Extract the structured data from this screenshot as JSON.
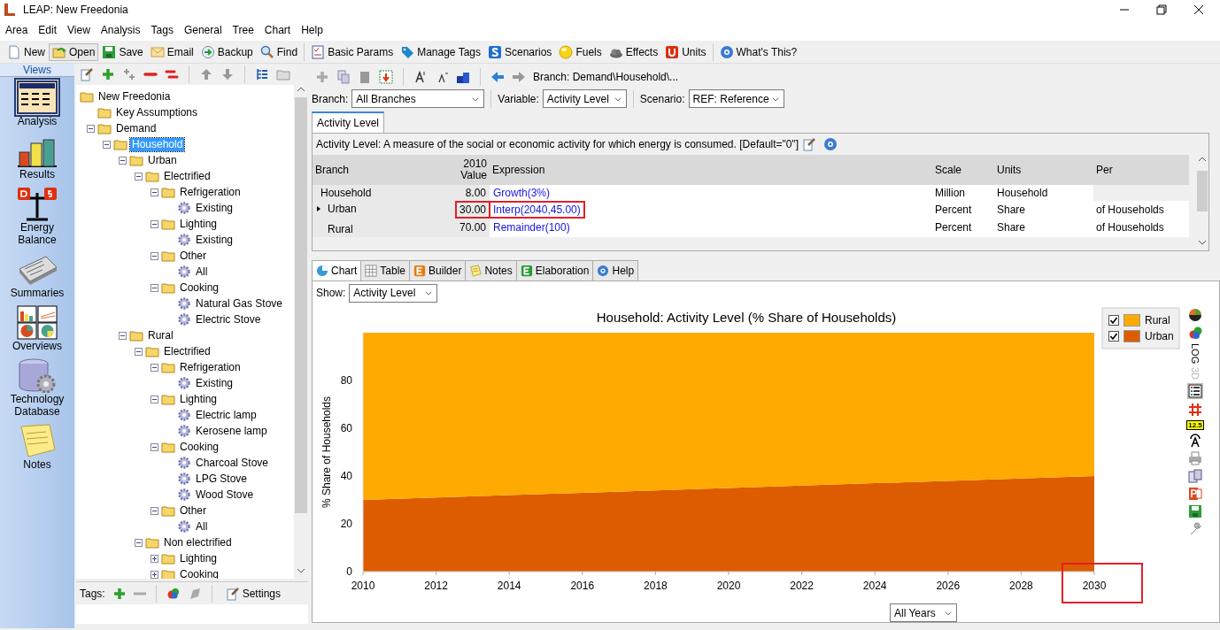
{
  "window": {
    "title": "LEAP: New Freedonia"
  },
  "menu": [
    "Area",
    "Edit",
    "View",
    "Analysis",
    "Tags",
    "General",
    "Tree",
    "Chart",
    "Help"
  ],
  "toolbar": [
    {
      "label": "New",
      "active": false
    },
    {
      "label": "Open",
      "active": true
    },
    {
      "label": "Save",
      "active": false
    },
    {
      "label": "Email",
      "active": false
    },
    {
      "label": "Backup",
      "active": false
    },
    {
      "label": "Find",
      "active": false
    },
    {
      "label": "Basic Params",
      "active": false
    },
    {
      "label": "Manage Tags",
      "active": false
    },
    {
      "label": "Scenarios",
      "active": false
    },
    {
      "label": "Fuels",
      "active": false
    },
    {
      "label": "Effects",
      "active": false
    },
    {
      "label": "Units",
      "active": false
    },
    {
      "label": "What's This?",
      "active": false
    }
  ],
  "views_header": "Views",
  "views": [
    {
      "label": "Analysis",
      "selected": true
    },
    {
      "label": "Results",
      "selected": false
    },
    {
      "label": "Energy Balance",
      "selected": false
    },
    {
      "label": "Summaries",
      "selected": false
    },
    {
      "label": "Overviews",
      "selected": false
    },
    {
      "label": "Technology Database",
      "selected": false
    },
    {
      "label": "Notes",
      "selected": false
    }
  ],
  "tree": {
    "items": [
      {
        "label": "New Freedonia",
        "kind": "folder",
        "selected": false,
        "children": [
          {
            "label": "Key Assumptions",
            "kind": "folder",
            "selected": false
          },
          {
            "label": "Demand",
            "kind": "folder",
            "selected": false,
            "expanded": true,
            "children": [
              {
                "label": "Household",
                "kind": "folder",
                "selected": true,
                "expanded": true,
                "children": [
                  {
                    "label": "Urban",
                    "kind": "folder",
                    "selected": false,
                    "expanded": true,
                    "children": [
                      {
                        "label": "Electrified",
                        "kind": "folder",
                        "selected": false,
                        "expanded": true,
                        "children": [
                          {
                            "label": "Refrigeration",
                            "kind": "folder",
                            "selected": false,
                            "expanded": true,
                            "children": [
                              {
                                "label": "Existing",
                                "kind": "device",
                                "selected": false
                              }
                            ]
                          },
                          {
                            "label": "Lighting",
                            "kind": "folder",
                            "selected": false,
                            "expanded": true,
                            "children": [
                              {
                                "label": "Existing",
                                "kind": "device",
                                "selected": false
                              }
                            ]
                          },
                          {
                            "label": "Other",
                            "kind": "folder",
                            "selected": false,
                            "expanded": true,
                            "children": [
                              {
                                "label": "All",
                                "kind": "device",
                                "selected": false
                              }
                            ]
                          },
                          {
                            "label": "Cooking",
                            "kind": "folder",
                            "selected": false,
                            "expanded": true,
                            "children": [
                              {
                                "label": "Natural Gas Stove",
                                "kind": "device",
                                "selected": false
                              },
                              {
                                "label": "Electric Stove",
                                "kind": "device",
                                "selected": false
                              }
                            ]
                          }
                        ]
                      }
                    ]
                  },
                  {
                    "label": "Rural",
                    "kind": "folder",
                    "selected": false,
                    "expanded": true,
                    "children": [
                      {
                        "label": "Electrified",
                        "kind": "folder",
                        "selected": false,
                        "expanded": true,
                        "children": [
                          {
                            "label": "Refrigeration",
                            "kind": "folder",
                            "selected": false,
                            "expanded": true,
                            "children": [
                              {
                                "label": "Existing",
                                "kind": "device",
                                "selected": false
                              }
                            ]
                          },
                          {
                            "label": "Lighting",
                            "kind": "folder",
                            "selected": false,
                            "expanded": true,
                            "children": [
                              {
                                "label": "Electric lamp",
                                "kind": "device",
                                "selected": false
                              },
                              {
                                "label": "Kerosene lamp",
                                "kind": "device",
                                "selected": false
                              }
                            ]
                          },
                          {
                            "label": "Cooking",
                            "kind": "folder",
                            "selected": false,
                            "expanded": true,
                            "children": [
                              {
                                "label": "Charcoal Stove",
                                "kind": "device",
                                "selected": false
                              },
                              {
                                "label": "LPG Stove",
                                "kind": "device",
                                "selected": false
                              },
                              {
                                "label": "Wood Stove",
                                "kind": "device",
                                "selected": false
                              }
                            ]
                          },
                          {
                            "label": "Other",
                            "kind": "folder",
                            "selected": false,
                            "expanded": true,
                            "children": [
                              {
                                "label": "All",
                                "kind": "device",
                                "selected": false
                              }
                            ]
                          }
                        ]
                      },
                      {
                        "label": "Non electrified",
                        "kind": "folder",
                        "selected": false,
                        "expanded": true,
                        "children": [
                          {
                            "label": "Lighting",
                            "kind": "folder",
                            "selected": false,
                            "expanded": false
                          },
                          {
                            "label": "Cooking",
                            "kind": "folder",
                            "selected": false,
                            "expanded": false
                          }
                        ]
                      }
                    ]
                  }
                ]
              }
            ]
          }
        ]
      }
    ]
  },
  "tags_bar": {
    "label": "Tags:",
    "settings": "Settings"
  },
  "branch_path": "Branch: Demand\\Household\\...",
  "selectors": [
    {
      "label": "Branch:",
      "value": "All Branches"
    },
    {
      "label": "Variable:",
      "value": "Activity Level"
    },
    {
      "label": "Scenario:",
      "value": "REF: Reference"
    }
  ],
  "variable_tabs": [
    {
      "label": "Activity Level",
      "selected": true
    }
  ],
  "description": "Activity Level: A measure of the social or economic activity for which energy is consumed. [Default=\"0\"]",
  "table": {
    "columns": [
      "Branch",
      "2010 Value",
      "Expression",
      "Scale",
      "Units",
      "Per"
    ],
    "rows": [
      {
        "branch": "Household",
        "value": "8.00",
        "expression": "Growth(3%)",
        "scale": "Million",
        "units": "Household",
        "current": false,
        "highlighted": false,
        "children": [
          {
            "branch": "Urban",
            "value": "30.00",
            "expression": "Interp(2040,45.00)",
            "scale": "Percent",
            "units": "Share",
            "per": "of Households",
            "current": true,
            "highlighted": true
          },
          {
            "branch": "Rural",
            "value": "70.00",
            "expression": "Remainder(100)",
            "scale": "Percent",
            "units": "Share",
            "per": "of Households",
            "current": false,
            "highlighted": false
          }
        ]
      }
    ]
  },
  "bottom_tabs": [
    {
      "label": "Chart",
      "selected": true
    },
    {
      "label": "Table",
      "selected": false
    },
    {
      "label": "Builder",
      "selected": false
    },
    {
      "label": "Notes",
      "selected": false
    },
    {
      "label": "Elaboration",
      "selected": false
    },
    {
      "label": "Help",
      "selected": false
    }
  ],
  "show": {
    "label": "Show:",
    "value": "Activity Level"
  },
  "chart": {
    "chart_data": {
      "type": "area",
      "title": "Household: Activity Level (% Share of Households)",
      "ylabel": "% Share of Households",
      "stacked": true,
      "x": [
        2010,
        2012,
        2014,
        2016,
        2018,
        2020,
        2022,
        2024,
        2026,
        2028,
        2030
      ],
      "series": [
        {
          "name": "Rural",
          "color": "#ffaa00",
          "values": [
            70,
            69,
            68,
            67,
            66,
            65,
            64,
            63,
            62,
            61,
            60
          ]
        },
        {
          "name": "Urban",
          "color": "#dd5c00",
          "values": [
            30,
            31,
            32,
            33,
            34,
            35,
            36,
            37,
            38,
            39,
            40
          ]
        }
      ],
      "xlim": [
        2010,
        2030
      ],
      "ylim": [
        0,
        100
      ],
      "xticks": [
        2010,
        2012,
        2014,
        2016,
        2018,
        2020,
        2022,
        2024,
        2026,
        2028,
        2030
      ],
      "yticks": [
        0,
        20,
        40,
        60,
        80
      ]
    },
    "last_tick_highlighted": true,
    "legend": [
      {
        "checked": true
      },
      {
        "checked": true
      }
    ]
  },
  "side_toggles": [
    {
      "label": "LOG",
      "disabled": false
    },
    {
      "label": "3D",
      "disabled": true
    }
  ],
  "number_badge": "12.5",
  "years": {
    "value": "All Years"
  }
}
